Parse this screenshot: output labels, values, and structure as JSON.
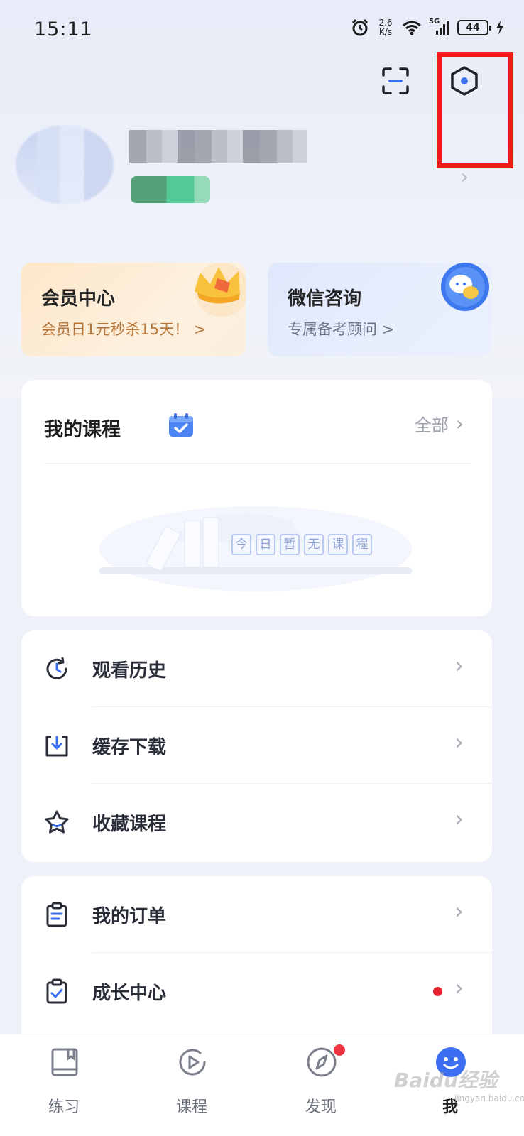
{
  "status_bar": {
    "time": "15:11",
    "net_speed_value": "2.6",
    "net_speed_unit": "K/s",
    "network_type": "5G",
    "battery": "44"
  },
  "promo": {
    "vip": {
      "title": "会员中心",
      "subtitle": "会员日1元秒杀15天！ >"
    },
    "wechat": {
      "title": "微信咨询",
      "subtitle": "专属备考顾问 >"
    }
  },
  "courses": {
    "title": "我的课程",
    "all_label": "全部",
    "empty_chars": [
      "今",
      "日",
      "暂",
      "无",
      "课",
      "程"
    ]
  },
  "menu_group_1": [
    {
      "label": "观看历史",
      "icon": "history-clock-icon"
    },
    {
      "label": "缓存下载",
      "icon": "download-icon"
    },
    {
      "label": "收藏课程",
      "icon": "star-icon"
    }
  ],
  "menu_group_2": [
    {
      "label": "我的订单",
      "icon": "clipboard-icon"
    },
    {
      "label": "成长中心",
      "icon": "clipboard-check-icon",
      "badge": true
    }
  ],
  "bottom_nav": [
    {
      "label": "练习",
      "icon": "book-icon"
    },
    {
      "label": "课程",
      "icon": "play-icon"
    },
    {
      "label": "发现",
      "icon": "compass-icon",
      "badge": true
    },
    {
      "label": "我",
      "icon": "profile-icon",
      "active": true
    }
  ],
  "watermark": {
    "text": "Baidu经验",
    "url": "jingyan.baidu.com"
  },
  "colors": {
    "accent_blue": "#3b6ef0",
    "highlight_red": "#ee1b1b",
    "badge_red": "#e8222f",
    "vip_text": "#b6763a"
  }
}
